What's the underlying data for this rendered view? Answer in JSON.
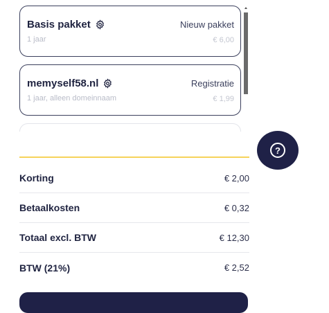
{
  "cart": {
    "items": [
      {
        "title": "Basis pakket",
        "subtitle": "1 jaar",
        "type": "Nieuw pakket",
        "price": "€ 6,00"
      },
      {
        "title": "memyself58.nl",
        "subtitle": "1 jaar, alleen domeinnaam",
        "type": "Registratie",
        "price": "€ 1,99"
      }
    ]
  },
  "summary": {
    "rows": [
      {
        "label": "Korting",
        "value": "€ 2,00"
      },
      {
        "label": "Betaalkosten",
        "value": "€ 0,32"
      },
      {
        "label": "Totaal excl. BTW",
        "value": "€ 12,30"
      },
      {
        "label": "BTW (21%)",
        "value": "€ 2,52"
      }
    ]
  },
  "help": {
    "glyph": "?",
    "icon": "help-question-icon"
  },
  "colors": {
    "navy": "#1f2147",
    "accent_yellow": "#f6d35a",
    "card_border": "#3a3f5c",
    "muted_text": "#b9bcc8"
  }
}
